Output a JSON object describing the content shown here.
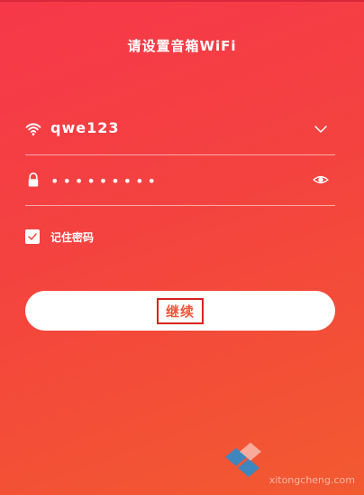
{
  "header": {
    "title": "请设置音箱WiFi"
  },
  "wifi": {
    "ssid": "qwe123",
    "icon": "wifi-icon",
    "dropdown_icon": "chevron-down-icon"
  },
  "password": {
    "masked_value": "•••••••••",
    "icon": "lock-icon",
    "toggle_icon": "eye-icon"
  },
  "remember": {
    "label": "记住密码",
    "checked": true
  },
  "actions": {
    "continue_label": "继续"
  },
  "watermark": {
    "text": "xitongcheng.com"
  },
  "colors": {
    "gradient_start": "#f6384a",
    "gradient_end": "#f25a30",
    "button_text": "#f2553a",
    "highlight_box": "#d6231f"
  }
}
